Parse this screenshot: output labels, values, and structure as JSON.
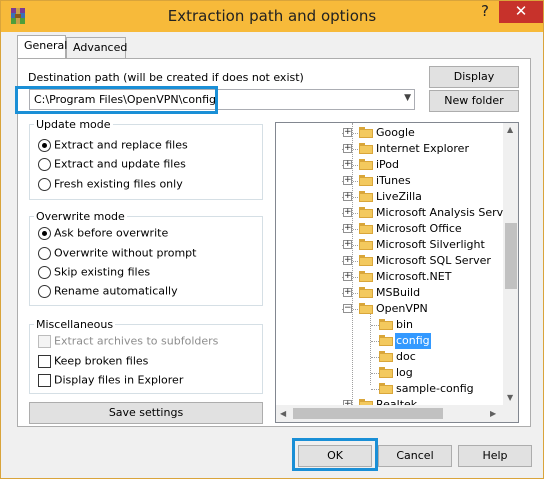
{
  "window": {
    "title": "Extraction path and options",
    "help_glyph": "?",
    "close_glyph": "✕"
  },
  "tabs": [
    {
      "label": "General",
      "active": true
    },
    {
      "label": "Advanced",
      "active": false
    }
  ],
  "destination": {
    "label": "Destination path (will be created if does not exist)",
    "value": "C:\\Program Files\\OpenVPN\\config"
  },
  "buttons": {
    "display": "Display",
    "new_folder": "New folder",
    "save_settings": "Save settings",
    "ok": "OK",
    "cancel": "Cancel",
    "help": "Help"
  },
  "update_mode": {
    "title": "Update mode",
    "options": [
      {
        "label": "Extract and replace files",
        "selected": true
      },
      {
        "label": "Extract and update files",
        "selected": false
      },
      {
        "label": "Fresh existing files only",
        "selected": false
      }
    ]
  },
  "overwrite_mode": {
    "title": "Overwrite mode",
    "options": [
      {
        "label": "Ask before overwrite",
        "selected": true
      },
      {
        "label": "Overwrite without prompt",
        "selected": false
      },
      {
        "label": "Skip existing files",
        "selected": false
      },
      {
        "label": "Rename automatically",
        "selected": false
      }
    ]
  },
  "misc": {
    "title": "Miscellaneous",
    "options": [
      {
        "label": "Extract archives to subfolders",
        "checked": false,
        "disabled": true
      },
      {
        "label": "Keep broken files",
        "checked": false,
        "disabled": false
      },
      {
        "label": "Display files in Explorer",
        "checked": false,
        "disabled": false
      }
    ]
  },
  "tree": {
    "items": [
      {
        "name": "Google",
        "expander": "+"
      },
      {
        "name": "Internet Explorer",
        "expander": "+"
      },
      {
        "name": "iPod",
        "expander": "+"
      },
      {
        "name": "iTunes",
        "expander": "+"
      },
      {
        "name": "LiveZilla",
        "expander": "+"
      },
      {
        "name": "Microsoft Analysis Services",
        "expander": "+"
      },
      {
        "name": "Microsoft Office",
        "expander": "+"
      },
      {
        "name": "Microsoft Silverlight",
        "expander": "+"
      },
      {
        "name": "Microsoft SQL Server",
        "expander": "+"
      },
      {
        "name": "Microsoft.NET",
        "expander": "+"
      },
      {
        "name": "MSBuild",
        "expander": "+"
      },
      {
        "name": "OpenVPN",
        "expander": "−"
      },
      {
        "name": "bin",
        "expander": ""
      },
      {
        "name": "config",
        "expander": "",
        "selected": true
      },
      {
        "name": "doc",
        "expander": ""
      },
      {
        "name": "log",
        "expander": ""
      },
      {
        "name": "sample-config",
        "expander": ""
      },
      {
        "name": "Realtek",
        "expander": "+"
      }
    ]
  },
  "colors": {
    "titlebar": "#f7ba3a",
    "close_button": "#c7322b",
    "highlight_box": "#1a8fd6",
    "selection": "#3399ff"
  }
}
